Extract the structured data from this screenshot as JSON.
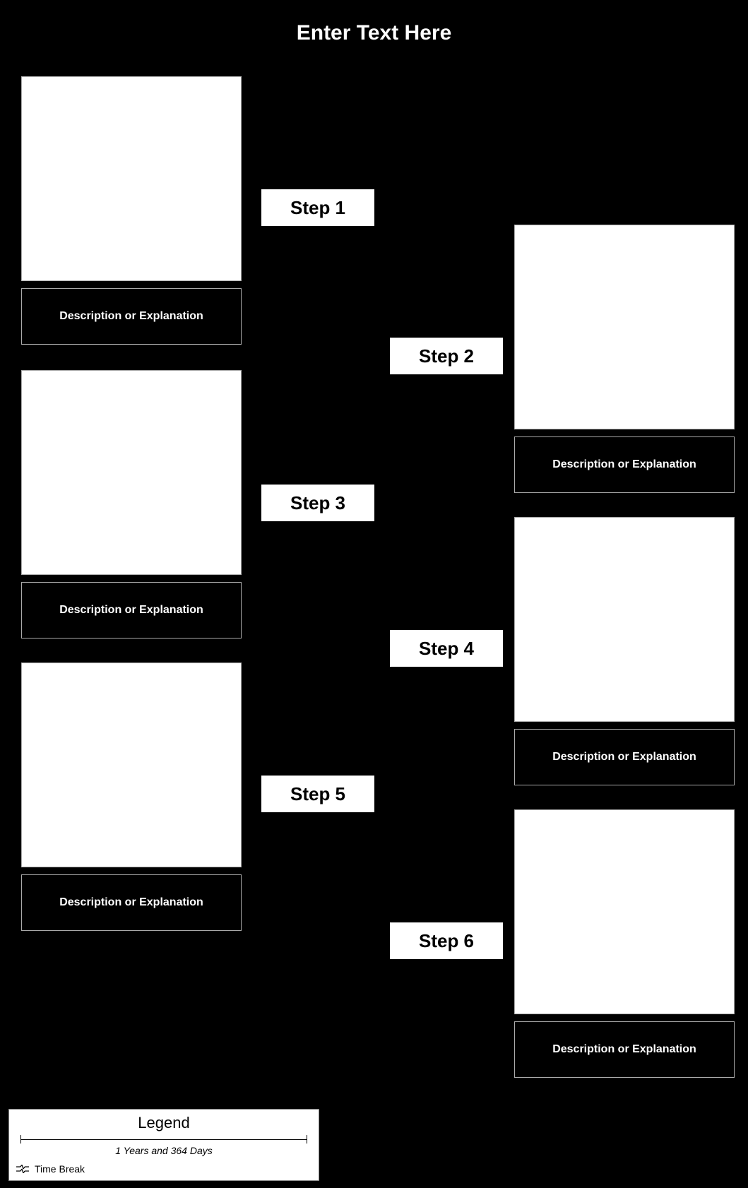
{
  "title": "Enter Text Here",
  "steps": [
    {
      "label": "Step 1",
      "description": "Description or Explanation"
    },
    {
      "label": "Step 2",
      "description": "Description or Explanation"
    },
    {
      "label": "Step 3",
      "description": "Description or Explanation"
    },
    {
      "label": "Step 4",
      "description": "Description or Explanation"
    },
    {
      "label": "Step 5",
      "description": "Description or Explanation"
    },
    {
      "label": "Step 6",
      "description": "Description or Explanation"
    }
  ],
  "legend": {
    "title": "Legend",
    "scale_label": "1 Years and 364 Days",
    "time_break_label": "Time Break"
  }
}
